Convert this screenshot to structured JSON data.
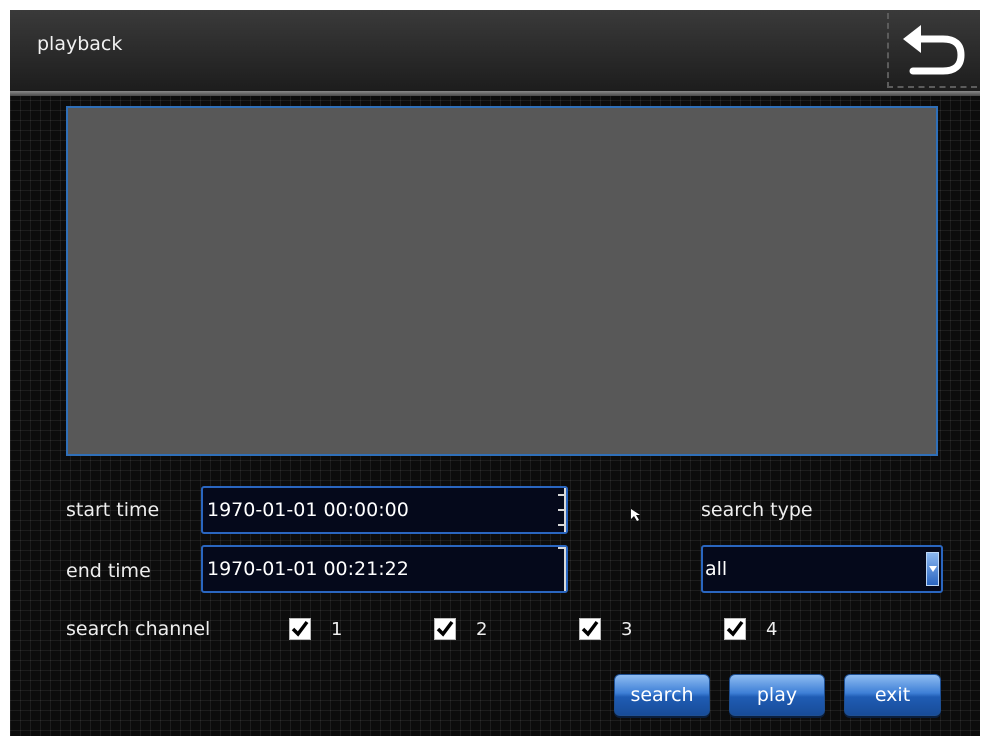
{
  "header": {
    "title": "playback",
    "back_icon": "back-arrow-icon"
  },
  "form": {
    "start_time_label": "start time",
    "start_time_value": "1970-01-01 00:00:00",
    "end_time_label": "end  time",
    "end_time_value": "1970-01-01 00:21:22",
    "search_type_label": "search type",
    "search_type_value": "all",
    "search_channel_label": "search  channel",
    "channels": [
      {
        "label": "1",
        "checked": true
      },
      {
        "label": "2",
        "checked": true
      },
      {
        "label": "3",
        "checked": true
      },
      {
        "label": "4",
        "checked": true
      }
    ]
  },
  "buttons": {
    "search": "search",
    "play": "play",
    "exit": "exit"
  },
  "colors": {
    "accent_blue": "#2a66c0",
    "video_bg": "#585858",
    "screen_bg": "#0c0c0c"
  }
}
